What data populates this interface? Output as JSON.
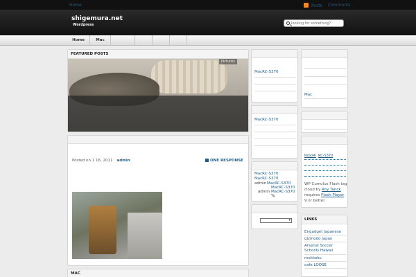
{
  "topbar": {
    "home": "Home",
    "posts": "Posts",
    "comments": "Comments"
  },
  "header": {
    "title": "shigemura.net",
    "tagline": "Wordpress"
  },
  "search": {
    "placeholder": "looking for something?"
  },
  "nav": {
    "tabs": [
      "Home",
      "Mac"
    ]
  },
  "featured": {
    "title": "FEATURED POSTS",
    "label": "Pictures"
  },
  "post": {
    "date": "Posted on 1 16, 2011",
    "author": "admin",
    "responses": "ONE RESPONSE"
  },
  "mac": {
    "title": "MAC"
  },
  "middle": {
    "box1_link": "MacRC-S370",
    "box2_link": "MacRC-S370",
    "box3": [
      "MacRC-S370",
      "MacRC-S370",
      "admin",
      "MacRC-S370",
      "MacRC-S370",
      "admin",
      "MacRC-S370",
      "Yu"
    ]
  },
  "right": {
    "mac_link": "Mac",
    "tags": [
      "PaSoRi",
      "RC-S370"
    ],
    "cumulus": "WP Cumulus Flash tag cloud by",
    "cumulus_author": "Roy Tanck",
    "cumulus_req": "requires",
    "flash": "Flash Player",
    "flash_ver": "9 or better.",
    "links_title": "LINKS",
    "links": [
      "Engadget Japanese",
      "gizmodo japan",
      "Arsenal Soccer Schools Hawaii",
      "mokkoku",
      "cafe LOOSE"
    ]
  }
}
